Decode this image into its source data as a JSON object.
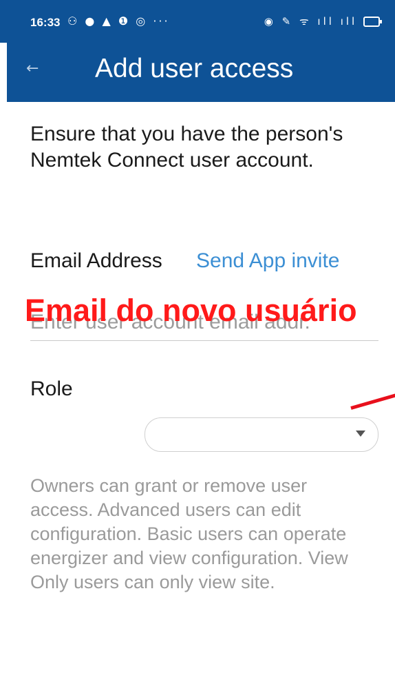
{
  "status_bar": {
    "time": "16:33",
    "left_icons": "⚇ ● ▲ ❶ ◎ ···",
    "right_icons": "◉ ✎ ᯤ ıll ıll"
  },
  "app_bar": {
    "back_icon": "←",
    "title": "Add user access"
  },
  "content": {
    "intro_text": "Ensure that you have the person's Nemtek Connect user account.",
    "email_label": "Email Address",
    "send_invite_link": "Send App invite",
    "email_placeholder": "Enter user account email addr.",
    "email_value": "",
    "role_label": "Role",
    "role_selected": "",
    "role_help_text": "Owners can grant or remove user access. Advanced users can edit configuration. Basic users can operate energizer and view configuration. View Only users can only view site."
  },
  "annotation": {
    "text": "Email do novo usuário",
    "color": "#ff1a1a"
  },
  "colors": {
    "brand": "#0e5296",
    "link": "#3c8fd4",
    "annotation_arrow": "#e8101c"
  }
}
